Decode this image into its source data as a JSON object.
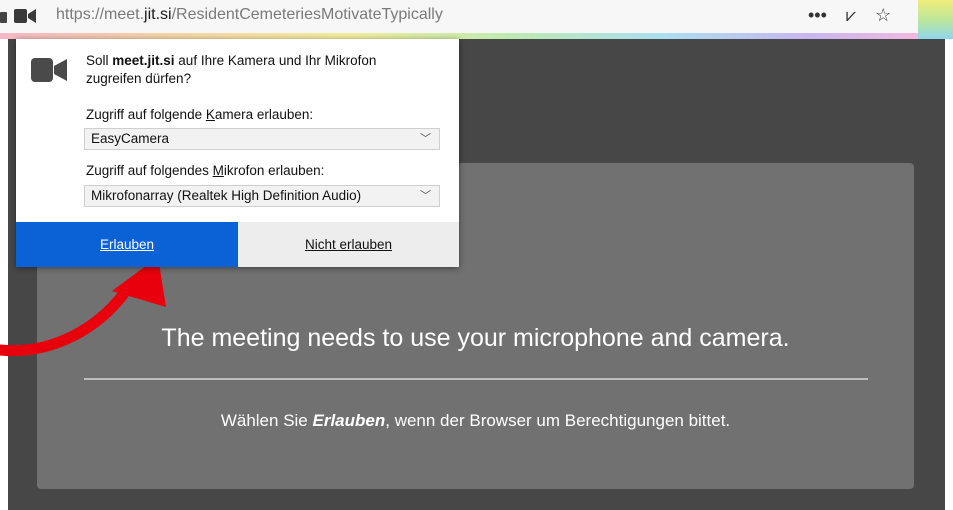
{
  "browser": {
    "url_prefix": "https://meet.",
    "url_host": "jit.si",
    "url_path": "/ResidentCemeteriesMotivateTypically",
    "more_icon": "•••",
    "pocket_icon": "⩗",
    "bookmark_icon": "☆"
  },
  "popup": {
    "question_prefix": "Soll ",
    "question_site": "meet.jit.si",
    "question_suffix": " auf Ihre Kamera und Ihr Mikrofon zugreifen dürfen?",
    "camera_label_a": "Zugriff auf folgende ",
    "camera_label_u": "K",
    "camera_label_b": "amera erlauben:",
    "camera_value": "EasyCamera",
    "mic_label_a": "Zugriff auf folgendes ",
    "mic_label_u": "M",
    "mic_label_b": "ikrofon erlauben:",
    "mic_value": "Mikrofonarray (Realtek High Definition Audio)",
    "allow_label": "Erlauben",
    "deny_label": "Nicht erlauben"
  },
  "page": {
    "title": "The meeting needs to use your microphone and camera.",
    "sub_prefix": "Wählen Sie ",
    "sub_emphasis": "Erlauben",
    "sub_suffix": ", wenn der Browser um Berechtigungen bittet."
  },
  "colors": {
    "allow_button": "#0a62d6",
    "arrow": "#e8000d",
    "card": "#717171",
    "background": "#474747"
  }
}
